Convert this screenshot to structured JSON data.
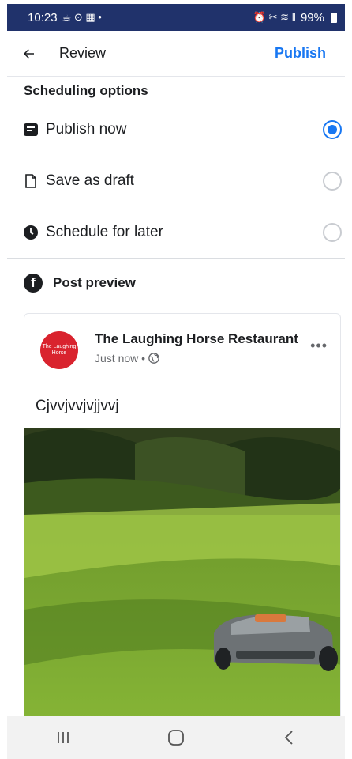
{
  "status_bar": {
    "time": "10:23",
    "left_icons": "☕ ⊙ ▦ •",
    "right_icons": "⏰ ✂ ≋ ‖",
    "battery": "99%"
  },
  "header": {
    "title": "Review",
    "publish_label": "Publish"
  },
  "scheduling": {
    "title": "Scheduling options",
    "options": [
      {
        "label": "Publish now",
        "icon": "publish-icon",
        "selected": true
      },
      {
        "label": "Save as draft",
        "icon": "draft-icon",
        "selected": false
      },
      {
        "label": "Schedule for later",
        "icon": "clock-icon",
        "selected": false
      }
    ]
  },
  "preview": {
    "title": "Post preview",
    "page_name": "The Laughing Horse Restaurant",
    "meta": "Just now •",
    "avatar_text": "The Laughing Horse",
    "text": "Cjvvjvvjvjjvvj"
  },
  "colors": {
    "accent": "#1877f2",
    "status_bar": "#20326b",
    "avatar": "#d9232e"
  }
}
